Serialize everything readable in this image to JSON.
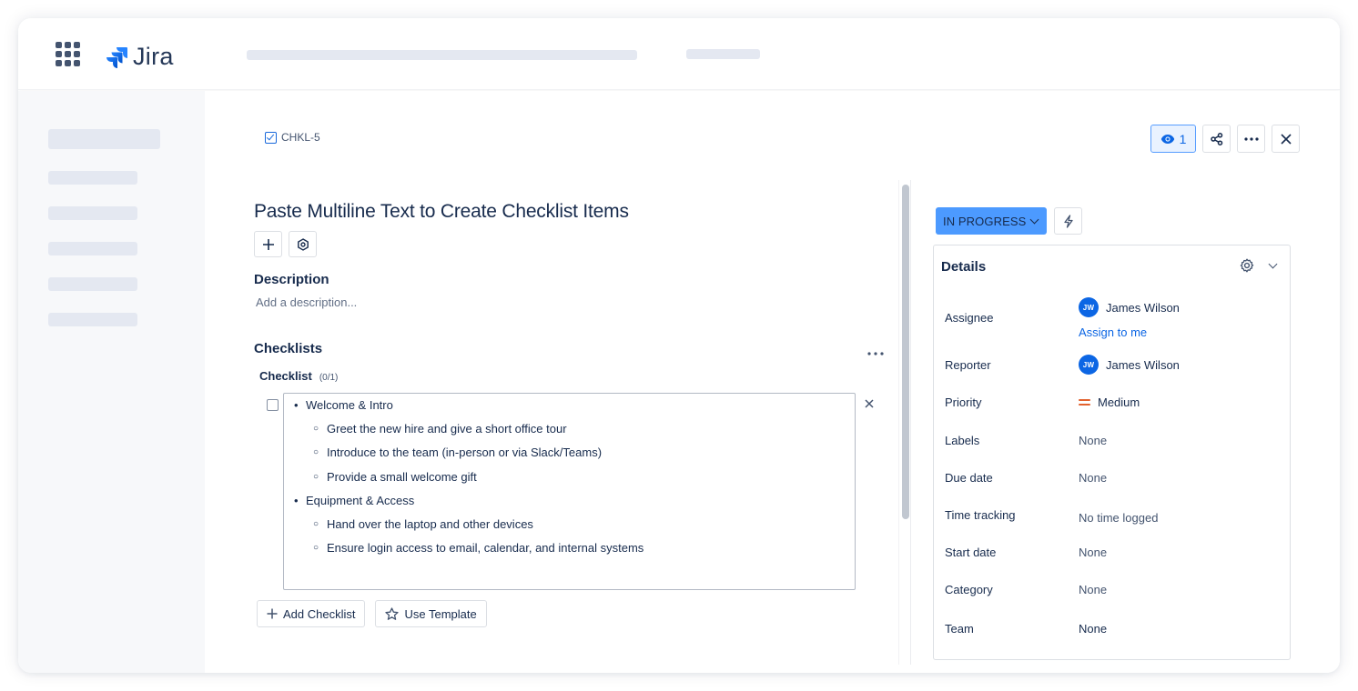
{
  "app": {
    "logo_text": "Jira"
  },
  "issue": {
    "key": "CHKL-5",
    "title": "Paste Multiline Text to Create Checklist Items",
    "watchers_count": "1"
  },
  "description": {
    "heading": "Description",
    "placeholder": "Add a description..."
  },
  "checklists": {
    "heading": "Checklists",
    "checklist_name": "Checklist",
    "checklist_count": "(0/1)",
    "items": [
      {
        "level": 1,
        "text": "Welcome & Intro"
      },
      {
        "level": 2,
        "text": "Greet the new hire and give a short office tour"
      },
      {
        "level": 2,
        "text": "Introduce to the team (in-person or via Slack/Teams)"
      },
      {
        "level": 2,
        "text": "Provide a small welcome gift"
      },
      {
        "level": 1,
        "text": "Equipment & Access"
      },
      {
        "level": 2,
        "text": "Hand over the laptop and other devices"
      },
      {
        "level": 2,
        "text": "Ensure login access to email, calendar, and internal systems"
      }
    ],
    "add_checklist_label": "Add Checklist",
    "use_template_label": "Use Template"
  },
  "status": {
    "label": "IN PROGRESS",
    "color": "#4c9aff"
  },
  "details": {
    "heading": "Details",
    "fields": {
      "assignee_label": "Assignee",
      "assignee_initials": "JW",
      "assignee_name": "James Wilson",
      "assign_to_me": "Assign to me",
      "reporter_label": "Reporter",
      "reporter_initials": "JW",
      "reporter_name": "James Wilson",
      "priority_label": "Priority",
      "priority_value": "Medium",
      "labels_label": "Labels",
      "labels_value": "None",
      "due_date_label": "Due date",
      "due_date_value": "None",
      "time_tracking_label": "Time tracking",
      "time_tracking_value": "No time logged",
      "start_date_label": "Start date",
      "start_date_value": "None",
      "category_label": "Category",
      "category_value": "None",
      "team_label": "Team",
      "team_value": "None"
    }
  },
  "colors": {
    "accent": "#0c66e4",
    "priority_medium": "#e2622e",
    "skeleton": "#e4e8f1"
  }
}
